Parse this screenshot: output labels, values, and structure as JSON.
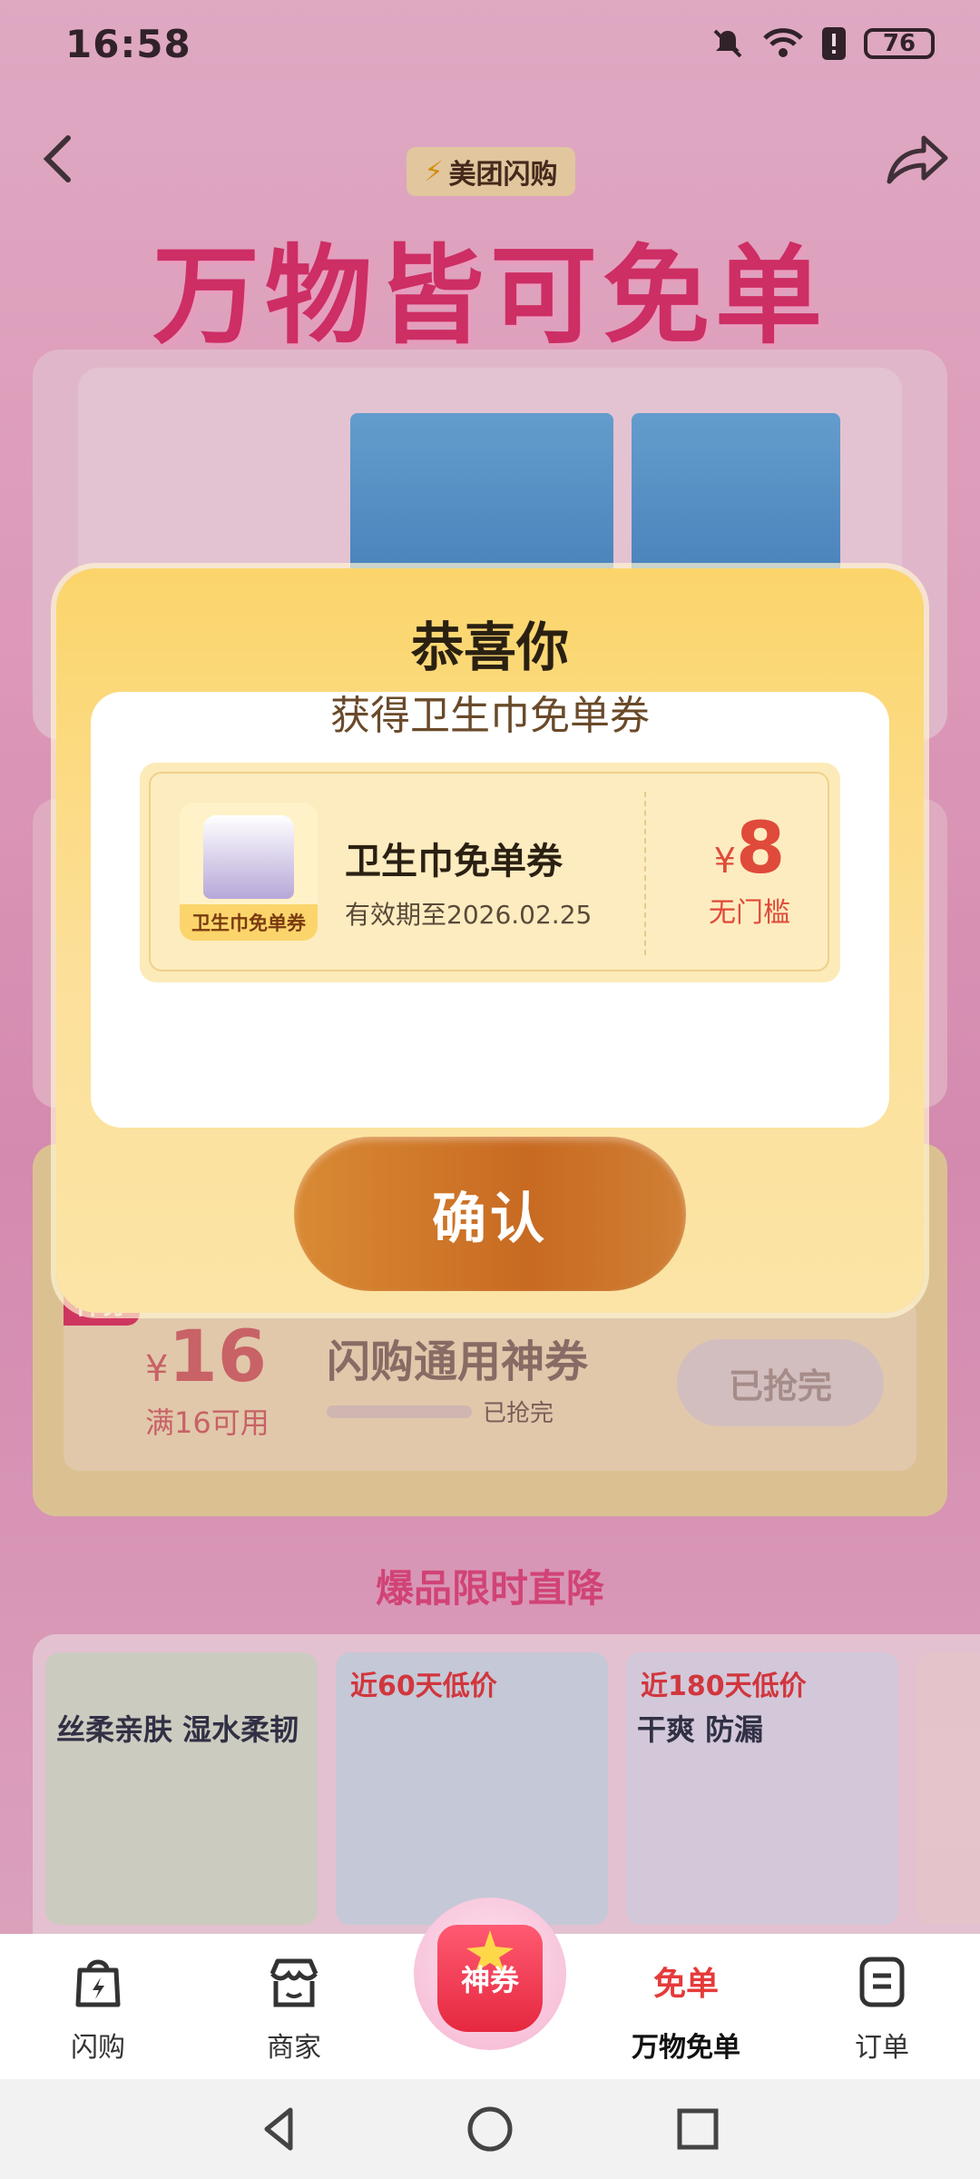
{
  "status_bar": {
    "time": "16:58",
    "battery": "76"
  },
  "header": {
    "brand": "美团闪购",
    "title": "万物皆可免单"
  },
  "background": {
    "coupon_badge": "神券",
    "coupon_yen": "¥",
    "coupon_amount": "16",
    "coupon_condition": "满16可用",
    "coupon_title": "闪购通用神券",
    "coupon_progress_text": "已抢完",
    "coupon_button": "已抢完",
    "section_heading": "爆品限时直降",
    "products": [
      {
        "tag": "",
        "name": "丝柔亲肤 湿水柔韧"
      },
      {
        "tag": "近60天低价",
        "name": ""
      },
      {
        "tag": "近180天低价",
        "name": "干爽 防漏"
      }
    ]
  },
  "modal": {
    "title": "恭喜你",
    "subtitle": "获得卫生巾免单券",
    "voucher": {
      "thumb_label": "卫生巾免单券",
      "name": "卫生巾免单券",
      "expiry": "有效期至2026.02.25",
      "yen": "¥",
      "amount": "8",
      "condition": "无门槛"
    },
    "confirm": "确认"
  },
  "tab_bar": {
    "tabs": [
      {
        "label": "闪购",
        "icon": "shopping-bag-icon"
      },
      {
        "label": "商家",
        "icon": "store-icon"
      },
      {
        "label": "神券",
        "icon": "coupon-bag-icon"
      },
      {
        "badge": "免单",
        "label": "万物免单",
        "icon": "free-order-icon"
      },
      {
        "label": "订单",
        "icon": "order-list-icon"
      }
    ]
  },
  "colors": {
    "accent": "#e0306a",
    "modal_gold": "#fbd56b",
    "confirm": "#c86a22",
    "price_red": "#e04a3a"
  }
}
